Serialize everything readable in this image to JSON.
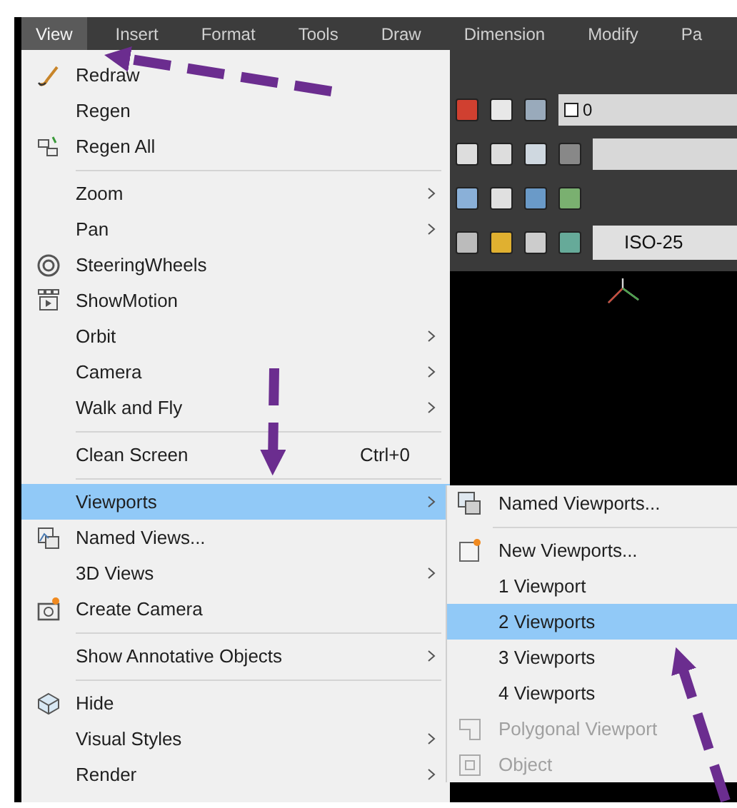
{
  "menu_bar": [
    {
      "label": "View",
      "selected": true
    },
    {
      "label": "Insert",
      "selected": false
    },
    {
      "label": "Format",
      "selected": false
    },
    {
      "label": "Tools",
      "selected": false
    },
    {
      "label": "Draw",
      "selected": false
    },
    {
      "label": "Dimension",
      "selected": false
    },
    {
      "label": "Modify",
      "selected": false
    },
    {
      "label": "Pa",
      "selected": false
    }
  ],
  "view_menu": [
    {
      "kind": "item",
      "label": "Redraw",
      "selected": false,
      "submenu": false
    },
    {
      "kind": "item",
      "label": "Regen",
      "selected": false,
      "submenu": false
    },
    {
      "kind": "item",
      "label": "Regen All",
      "selected": false,
      "submenu": false
    },
    {
      "kind": "separator"
    },
    {
      "kind": "item",
      "label": "Zoom",
      "selected": false,
      "submenu": true
    },
    {
      "kind": "item",
      "label": "Pan",
      "selected": false,
      "submenu": true
    },
    {
      "kind": "item",
      "label": "SteeringWheels",
      "selected": false,
      "submenu": false
    },
    {
      "kind": "item",
      "label": "ShowMotion",
      "selected": false,
      "submenu": false
    },
    {
      "kind": "item",
      "label": "Orbit",
      "selected": false,
      "submenu": true
    },
    {
      "kind": "item",
      "label": "Camera",
      "selected": false,
      "submenu": true
    },
    {
      "kind": "item",
      "label": "Walk and Fly",
      "selected": false,
      "submenu": true
    },
    {
      "kind": "separator"
    },
    {
      "kind": "item",
      "label": "Clean Screen",
      "selected": false,
      "submenu": false,
      "shortcut": "Ctrl+0"
    },
    {
      "kind": "separator"
    },
    {
      "kind": "item",
      "label": "Viewports",
      "selected": true,
      "submenu": true
    },
    {
      "kind": "item",
      "label": "Named Views...",
      "selected": false,
      "submenu": false
    },
    {
      "kind": "item",
      "label": "3D Views",
      "selected": false,
      "submenu": true
    },
    {
      "kind": "item",
      "label": "Create Camera",
      "selected": false,
      "submenu": false
    },
    {
      "kind": "separator"
    },
    {
      "kind": "item",
      "label": "Show Annotative Objects",
      "selected": false,
      "submenu": true
    },
    {
      "kind": "separator"
    },
    {
      "kind": "item",
      "label": "Hide",
      "selected": false,
      "submenu": false
    },
    {
      "kind": "item",
      "label": "Visual Styles",
      "selected": false,
      "submenu": true
    },
    {
      "kind": "item",
      "label": "Render",
      "selected": false,
      "submenu": true
    }
  ],
  "viewports_submenu": [
    {
      "kind": "item",
      "label": "Named Viewports...",
      "selected": false,
      "disabled": false
    },
    {
      "kind": "separator"
    },
    {
      "kind": "item",
      "label": "New Viewports...",
      "selected": false,
      "disabled": false
    },
    {
      "kind": "item",
      "label": "1 Viewport",
      "selected": false,
      "disabled": false
    },
    {
      "kind": "item",
      "label": "2 Viewports",
      "selected": true,
      "disabled": false
    },
    {
      "kind": "item",
      "label": "3 Viewports",
      "selected": false,
      "disabled": false
    },
    {
      "kind": "item",
      "label": "4 Viewports",
      "selected": false,
      "disabled": false
    },
    {
      "kind": "item",
      "label": "Polygonal Viewport",
      "selected": false,
      "disabled": true
    },
    {
      "kind": "item",
      "label": "Object",
      "selected": false,
      "disabled": true
    }
  ],
  "toolbar": {
    "layer": "0",
    "dim_style": "ISO-25"
  }
}
